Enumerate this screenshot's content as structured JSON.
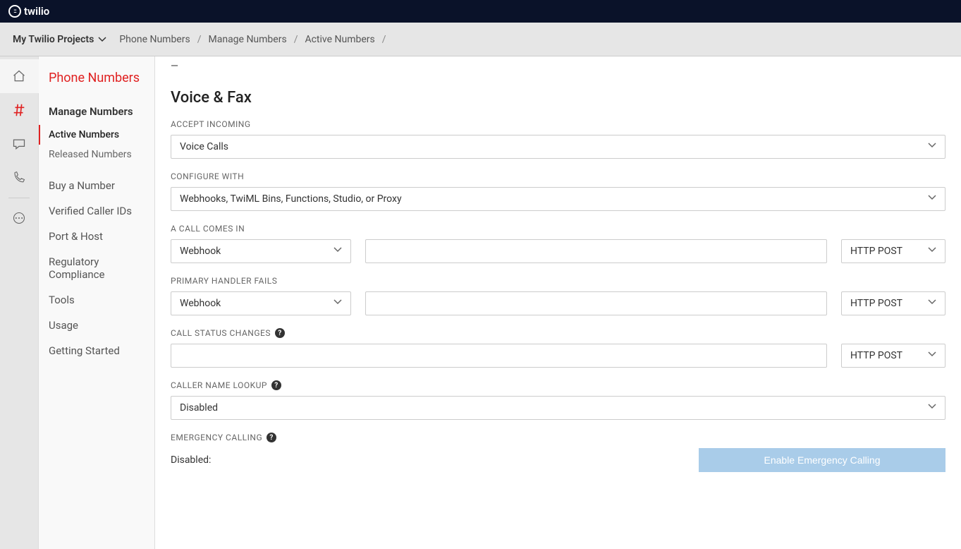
{
  "header": {
    "brand": "twilio"
  },
  "breadcrumb": {
    "project_label": "My Twilio Projects",
    "items": [
      "Phone Numbers",
      "Manage Numbers",
      "Active Numbers"
    ]
  },
  "side_nav": {
    "title": "Phone Numbers",
    "manage_label": "Manage Numbers",
    "subitems": {
      "active": "Active Numbers",
      "released": "Released Numbers"
    },
    "links": {
      "buy": "Buy a Number",
      "verified": "Verified Caller IDs",
      "port": "Port & Host",
      "regulatory": "Regulatory Compliance",
      "tools": "Tools",
      "usage": "Usage",
      "getting_started": "Getting Started"
    }
  },
  "main": {
    "notes_value": "—",
    "section_title": "Voice & Fax",
    "labels": {
      "accept_incoming": "ACCEPT INCOMING",
      "configure_with": "CONFIGURE WITH",
      "call_comes_in": "A CALL COMES IN",
      "primary_handler_fails": "PRIMARY HANDLER FAILS",
      "call_status_changes": "CALL STATUS CHANGES",
      "caller_name_lookup": "CALLER NAME LOOKUP",
      "emergency_calling": "EMERGENCY CALLING"
    },
    "values": {
      "accept_incoming": "Voice Calls",
      "configure_with": "Webhooks, TwiML Bins, Functions, Studio, or Proxy",
      "call_comes_in_type": "Webhook",
      "call_comes_in_url": "",
      "call_comes_in_method": "HTTP POST",
      "primary_fails_type": "Webhook",
      "primary_fails_url": "",
      "primary_fails_method": "HTTP POST",
      "status_changes_url": "",
      "status_changes_method": "HTTP POST",
      "caller_name_lookup": "Disabled",
      "emergency_status": "Disabled:",
      "emergency_button": "Enable Emergency Calling"
    }
  }
}
